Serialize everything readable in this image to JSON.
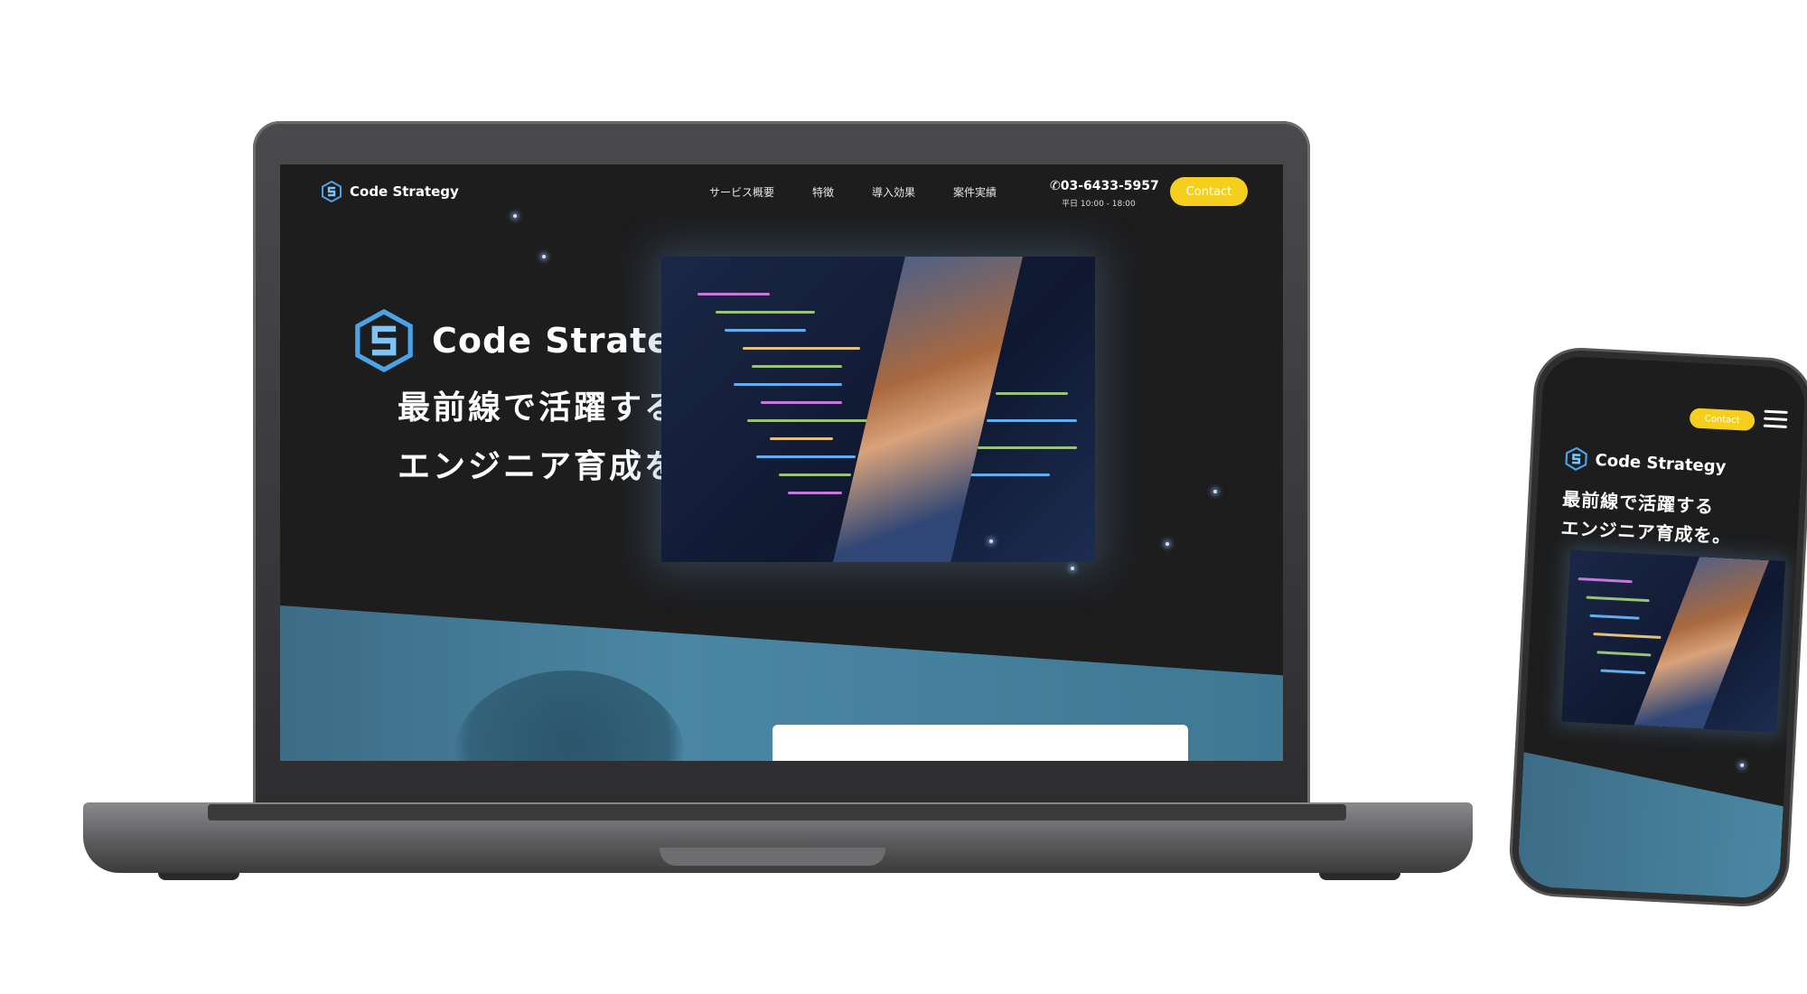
{
  "site": {
    "brand": "Code Strategy",
    "nav": [
      "サービス概要",
      "特徴",
      "導入効果",
      "案件実績"
    ],
    "phone_number": "03-6433-5957",
    "hours": "平日 10:00 - 18:00",
    "contact_label": "Contact",
    "hero_line1": "最前線で活躍する",
    "hero_line2": "エンジニア育成を。"
  },
  "colors": {
    "accent": "#f4cf1e",
    "logo_blue": "#4aa3e8",
    "background": "#1d1d1e",
    "band_teal": "#4a87a3"
  },
  "icons": {
    "logo": "code-strategy-logo-icon",
    "phone": "phone-icon",
    "menu": "hamburger-menu-icon"
  }
}
